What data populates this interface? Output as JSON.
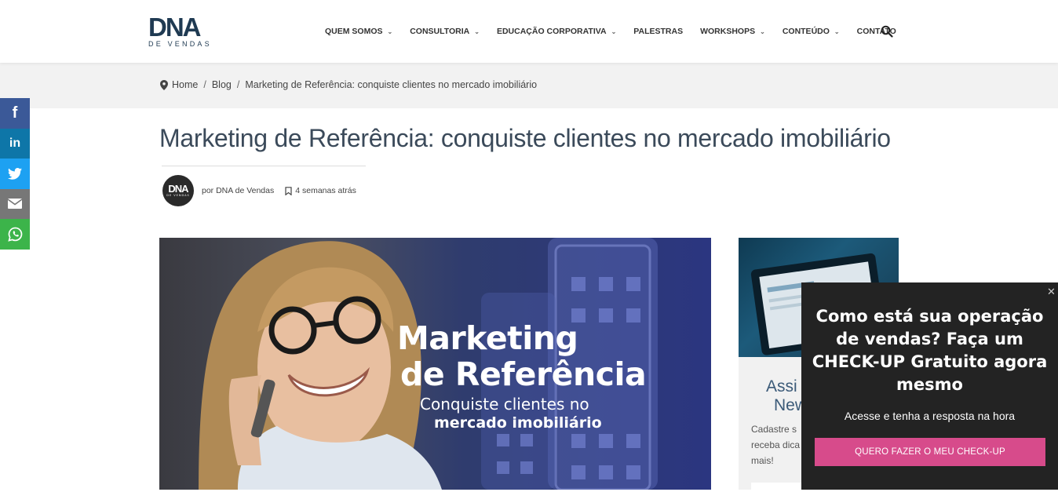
{
  "logo": {
    "main": "DNA",
    "sub": "DE VENDAS"
  },
  "nav": {
    "items": [
      {
        "label": "QUEM SOMOS",
        "has_menu": true
      },
      {
        "label": "CONSULTORIA",
        "has_menu": true
      },
      {
        "label": "EDUCAÇÃO CORPORATIVA",
        "has_menu": true
      },
      {
        "label": "PALESTRAS",
        "has_menu": false
      },
      {
        "label": "WORKSHOPS",
        "has_menu": true
      },
      {
        "label": "CONTEÚDO",
        "has_menu": true
      },
      {
        "label": "CONTATO",
        "has_menu": false
      }
    ],
    "chevron": "⌄",
    "search_icon": "search-icon"
  },
  "breadcrumb": {
    "home": "Home",
    "blog": "Blog",
    "current": "Marketing de Referência: conquiste clientes no mercado imobiliário",
    "separator": "/"
  },
  "social": [
    "facebook-icon",
    "linkedin-icon",
    "twitter-icon",
    "email-icon",
    "whatsapp-icon"
  ],
  "social_glyphs": {
    "facebook": "f",
    "linkedin": "in"
  },
  "post": {
    "title": "Marketing de Referência: conquiste clientes no mercado imobiliário",
    "author": "por DNA de Vendas",
    "date": "4 semanas atrás",
    "avatar_main": "DNA",
    "avatar_sub": "DE VENDAS"
  },
  "hero": {
    "line1": "Marketing",
    "line2": "de Referência",
    "line3": "Conquiste clientes no",
    "line4": "mercado imobiliário"
  },
  "sidebar": {
    "title_line1": "Assi",
    "title_line2": "New",
    "text": "Cadastre s receba dica mais!"
  },
  "popup": {
    "close": "✕",
    "heading": "Como está sua operação de vendas? Faça um CHECK-UP Gratuito agora mesmo",
    "text": "Acesse e tenha a resposta na hora",
    "button": "QUERO FAZER O MEU CHECK-UP"
  },
  "colors": {
    "brand": "#1f3a52",
    "popup_bg": "#232323",
    "popup_button": "#d74b8b",
    "facebook": "#3b5998",
    "linkedin": "#0e76a8",
    "twitter": "#1da1f2",
    "email": "#777777",
    "whatsapp": "#3cb44a"
  }
}
